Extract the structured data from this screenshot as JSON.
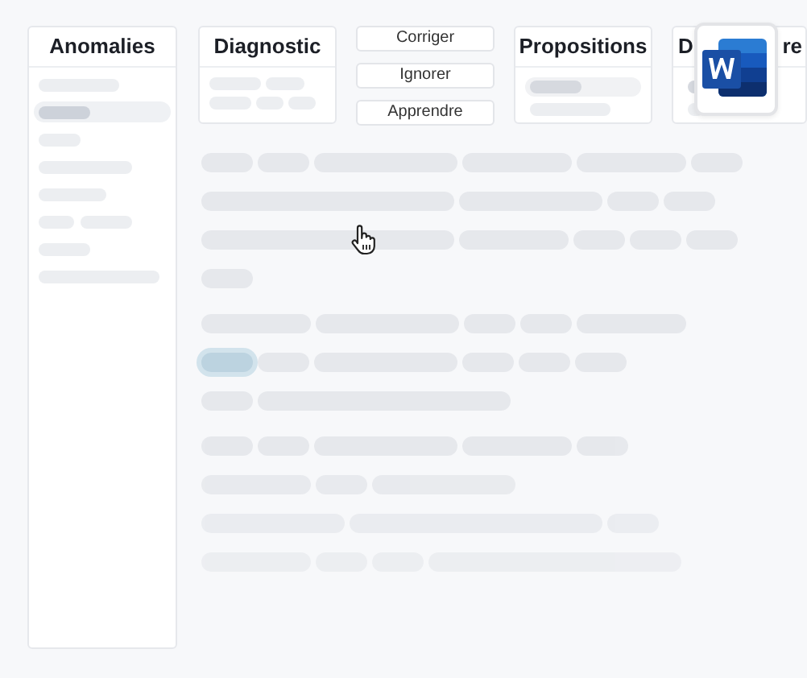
{
  "sidebar": {
    "title": "Anomalies",
    "items": [
      {
        "selected": false
      },
      {
        "selected": true
      },
      {
        "selected": false
      },
      {
        "selected": false
      },
      {
        "selected": false
      },
      {
        "selected": false
      },
      {
        "selected": false
      },
      {
        "selected": false
      }
    ]
  },
  "diagnostic": {
    "title": "Diagnostic"
  },
  "actions": [
    "Corriger",
    "Ignorer",
    "Apprendre"
  ],
  "propositions": {
    "title": "Propositions"
  },
  "partial_card": {
    "title_start": "D",
    "title_end": "re"
  },
  "document": {
    "paragraphs": [
      {
        "lines": [
          {
            "words": [
              {
                "kind": "s",
                "highlighted": false
              },
              {
                "kind": "s",
                "highlighted": false
              },
              {
                "kind": "l",
                "highlighted": false
              },
              {
                "kind": "m",
                "highlighted": false
              },
              {
                "kind": "m",
                "highlighted": false
              },
              {
                "kind": "s",
                "highlighted": false
              }
            ]
          },
          {
            "words": [
              {
                "kind": "x",
                "highlighted": false
              },
              {
                "kind": "l",
                "highlighted": false
              },
              {
                "kind": "s",
                "highlighted": false
              },
              {
                "kind": "s",
                "highlighted": false
              }
            ]
          },
          {
            "words": [
              {
                "kind": "x",
                "highlighted": false
              },
              {
                "kind": "m",
                "highlighted": false
              },
              {
                "kind": "s",
                "highlighted": false
              },
              {
                "kind": "s",
                "highlighted": false
              },
              {
                "kind": "s",
                "highlighted": false
              }
            ]
          },
          {
            "words": [
              {
                "kind": "s",
                "highlighted": false
              }
            ]
          }
        ]
      },
      {
        "lines": [
          {
            "words": [
              {
                "kind": "m",
                "highlighted": false
              },
              {
                "kind": "l",
                "highlighted": false
              },
              {
                "kind": "s",
                "highlighted": false
              },
              {
                "kind": "s",
                "highlighted": false
              },
              {
                "kind": "m",
                "highlighted": false
              }
            ]
          },
          {
            "words": [
              {
                "kind": "s",
                "highlighted": true
              },
              {
                "kind": "s",
                "highlighted": false
              },
              {
                "kind": "l",
                "highlighted": false
              },
              {
                "kind": "s",
                "highlighted": false
              },
              {
                "kind": "s",
                "highlighted": false
              },
              {
                "kind": "s",
                "highlighted": false
              }
            ]
          },
          {
            "words": [
              {
                "kind": "s",
                "highlighted": false
              },
              {
                "kind": "x",
                "highlighted": false
              }
            ]
          }
        ]
      },
      {
        "lines": [
          {
            "words": [
              {
                "kind": "s",
                "highlighted": false
              },
              {
                "kind": "s",
                "highlighted": false
              },
              {
                "kind": "l",
                "highlighted": false
              },
              {
                "kind": "m",
                "highlighted": false
              },
              {
                "kind": "s",
                "highlighted": false
              }
            ]
          },
          {
            "words": [
              {
                "kind": "m",
                "highlighted": false
              },
              {
                "kind": "s",
                "highlighted": false
              },
              {
                "kind": "l",
                "highlighted": false
              }
            ]
          },
          {
            "words": [
              {
                "kind": "l",
                "highlighted": false
              },
              {
                "kind": "x",
                "highlighted": false
              },
              {
                "kind": "s",
                "highlighted": false
              }
            ]
          },
          {
            "words": [
              {
                "kind": "m",
                "highlighted": false
              },
              {
                "kind": "s",
                "highlighted": false
              },
              {
                "kind": "s",
                "highlighted": false
              },
              {
                "kind": "x",
                "highlighted": false
              }
            ]
          }
        ]
      }
    ]
  }
}
